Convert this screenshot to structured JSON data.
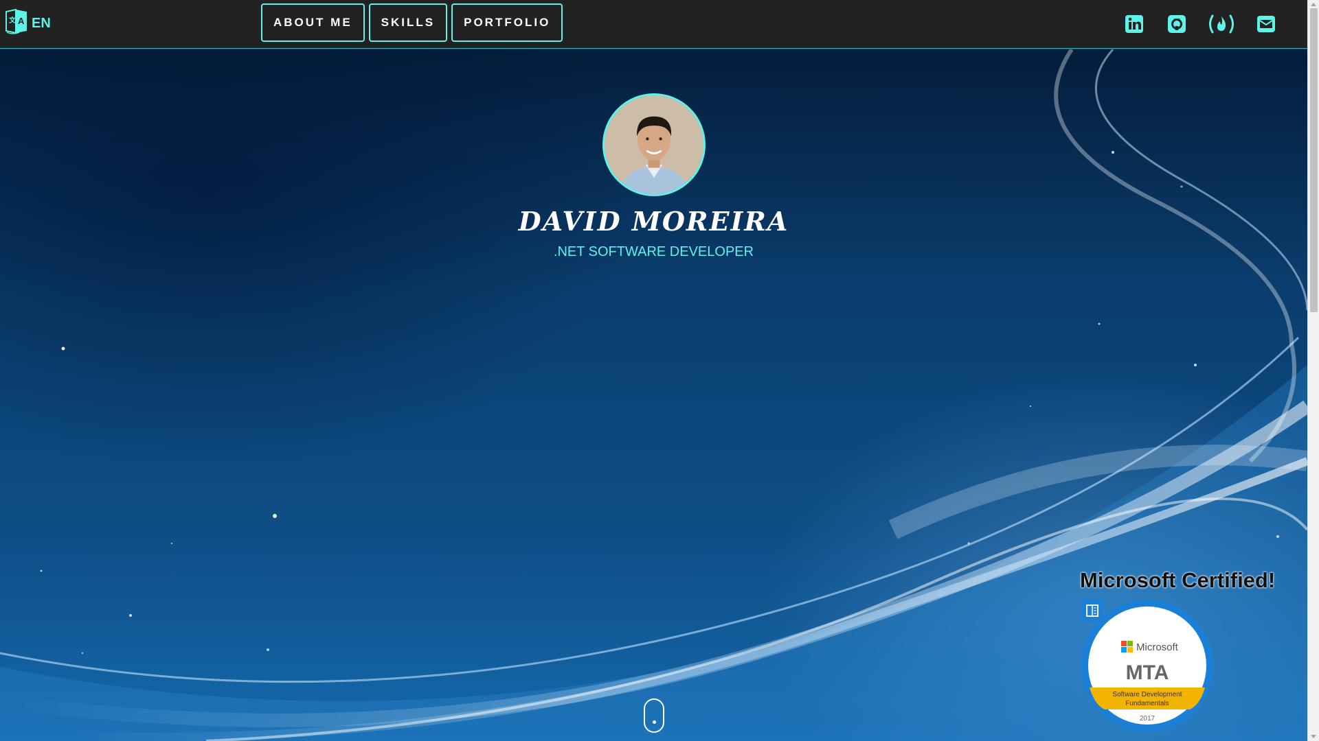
{
  "header": {
    "language": {
      "label": "EN",
      "icon": "translate-icon"
    },
    "nav": [
      {
        "label": "ABOUT ME"
      },
      {
        "label": "SKILLS"
      },
      {
        "label": "PORTFOLIO"
      }
    ],
    "social": [
      {
        "icon": "linkedin-icon"
      },
      {
        "icon": "github-icon"
      },
      {
        "icon": "freecodecamp-icon"
      },
      {
        "icon": "envelope-icon"
      }
    ]
  },
  "hero": {
    "name": "DAVID MOREIRA",
    "role": ".NET SOFTWARE DEVELOPER",
    "scroll_hint_icon": "mouse-scroll-icon"
  },
  "certification": {
    "title": "Microsoft Certified!",
    "badge": {
      "brand": "Microsoft",
      "code": "MTA",
      "subject_line1": "Software Development",
      "subject_line2": "Fundamentals",
      "year": "2017"
    }
  },
  "colors": {
    "accent": "#5ef3ea",
    "header_bg": "#222222",
    "badge_blue": "#1a7fd6",
    "badge_gold": "#f2b400"
  }
}
